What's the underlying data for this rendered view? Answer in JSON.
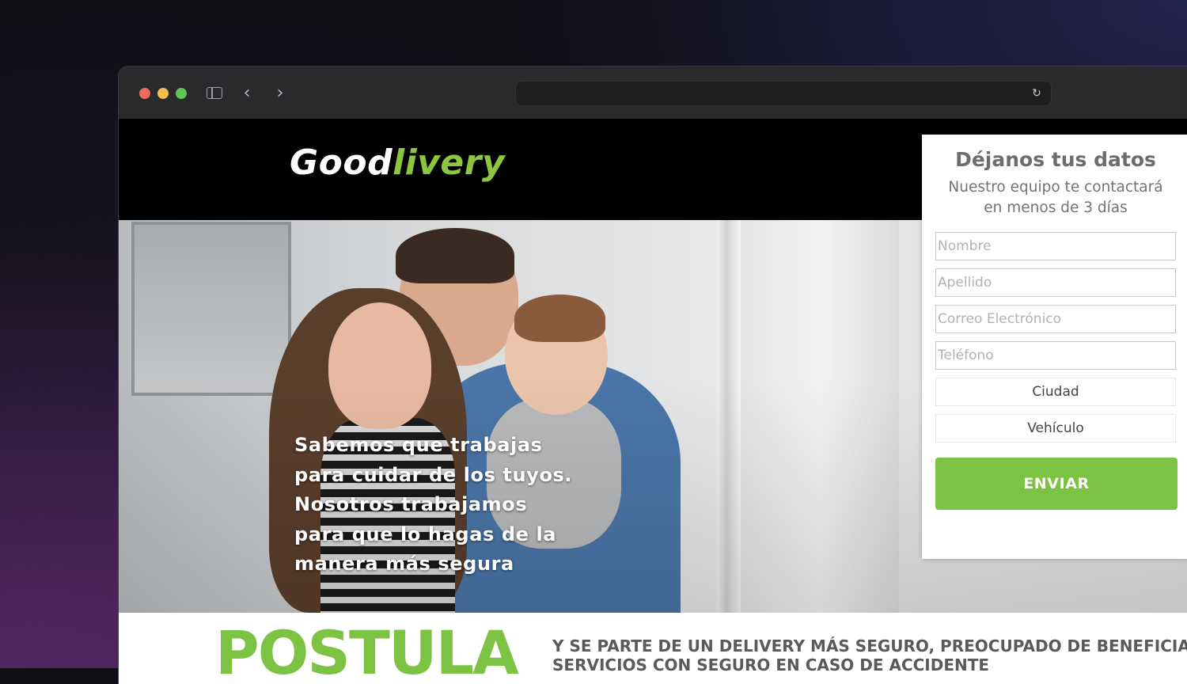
{
  "browser": {
    "url": "",
    "back_icon": "chevron-left-icon",
    "forward_icon": "chevron-right-icon",
    "sidebar_icon": "sidebar-icon",
    "reload_icon": "reload-icon",
    "back_glyph": "‹",
    "forward_glyph": "›",
    "reload_glyph": "↻"
  },
  "header": {
    "logo_part1": "Good",
    "logo_part2": "livery"
  },
  "hero": {
    "lines": [
      "Sabemos que trabajas",
      "para cuidar de los tuyos.",
      "Nosotros trabajamos",
      "para que lo hagas de la",
      "manera más segura"
    ]
  },
  "form": {
    "title": "Déjanos tus datos",
    "subtitle_line1": "Nuestro equipo te contactará",
    "subtitle_line2": "en menos de 3 días",
    "fields": {
      "nombre_placeholder": "Nombre",
      "apellido_placeholder": "Apellido",
      "correo_placeholder": "Correo Electrónico",
      "telefono_placeholder": "Teléfono"
    },
    "selects": {
      "ciudad": "Ciudad",
      "vehiculo": "Vehículo"
    },
    "submit_label": "ENVIAR"
  },
  "postula": {
    "title": "POSTULA",
    "desc_line1": "Y SE PARTE DE UN DELIVERY MÁS SEGURO, PREOCUPADO DE BENEFICIA",
    "desc_line2": "SERVICIOS CON SEGURO EN CASO DE ACCIDENTE"
  },
  "colors": {
    "brand_green": "#7cc243",
    "logo_green": "#8cc63f",
    "header_bg": "#000000"
  }
}
